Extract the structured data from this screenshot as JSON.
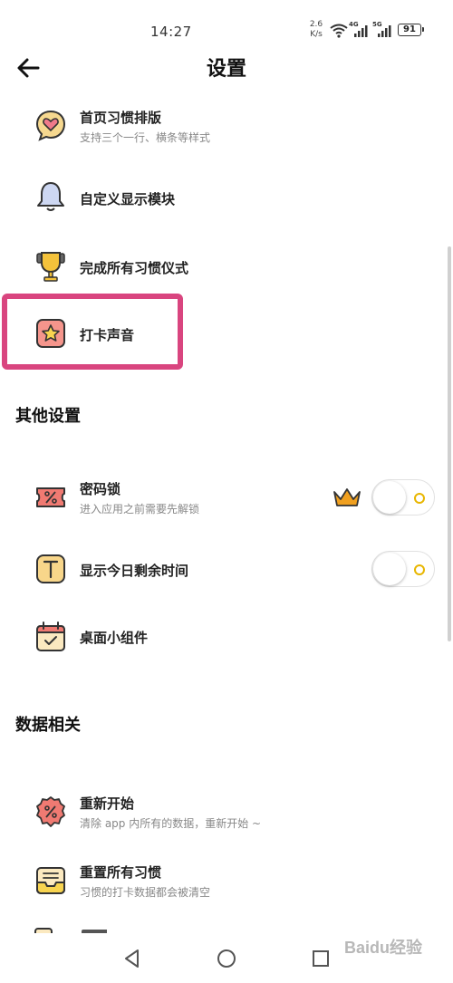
{
  "status": {
    "time": "14:27",
    "netspeed_value": "2.6",
    "netspeed_unit": "K/s",
    "sig1_label": "4G",
    "sig2_label": "5G",
    "battery": "91"
  },
  "header": {
    "title": "设置"
  },
  "items": [
    {
      "label": "首页习惯排版",
      "sub": "支持三个一行、横条等样式"
    },
    {
      "label": "自定义显示模块"
    },
    {
      "label": "完成所有习惯仪式"
    },
    {
      "label": "打卡声音"
    }
  ],
  "sections": {
    "other": "其他设置",
    "data": "数据相关"
  },
  "other_items": [
    {
      "label": "密码锁",
      "sub": "进入应用之前需要先解锁",
      "toggle_on": false
    },
    {
      "label": "显示今日剩余时间",
      "toggle_on": false
    },
    {
      "label": "桌面小组件"
    }
  ],
  "data_items": [
    {
      "label": "重新开始",
      "sub": "清除 app 内所有的数据，重新开始 ~"
    },
    {
      "label": "重置所有习惯",
      "sub": "习惯的打卡数据都会被清空"
    }
  ],
  "watermark": "Baidu经验",
  "colors": {
    "highlight": "#d9457f",
    "toggle_dot": "#e8b600",
    "crown": "#f0a020"
  }
}
